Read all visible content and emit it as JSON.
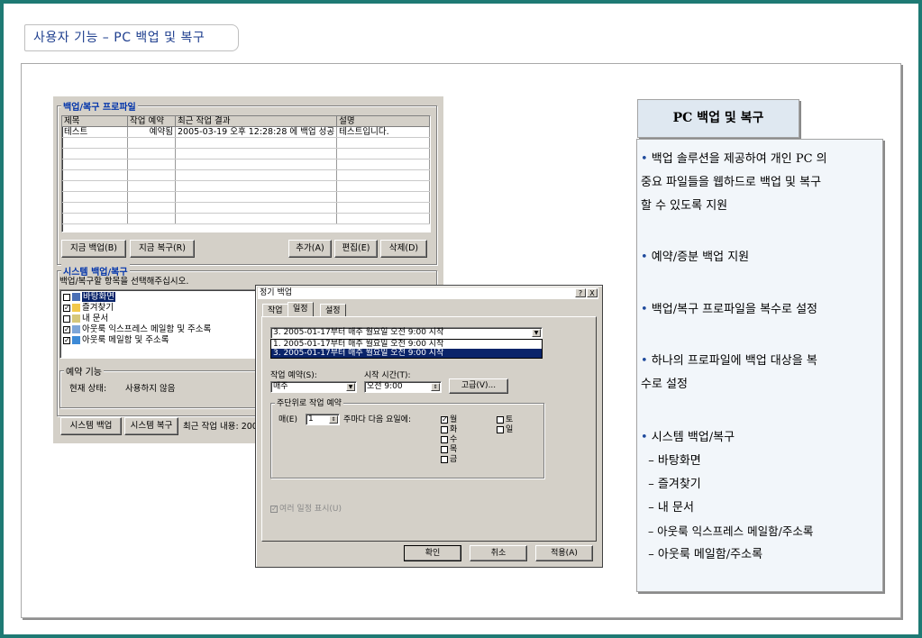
{
  "header": {
    "title": "사용자 기능 – PC 백업 및 복구"
  },
  "profile_group": {
    "title": "백업/복구 프로파일",
    "columns": [
      "제목",
      "작업 예약",
      "최근 작업 결과",
      "설명"
    ],
    "rows": [
      [
        "테스트",
        "예약됨",
        "2005-03-19 오후 12:28:28 에 백업 성공",
        "테스트입니다."
      ]
    ],
    "buttons": {
      "backup_now": "지금 백업(B)",
      "restore_now": "지금 복구(R)",
      "add": "추가(A)",
      "edit": "편집(E)",
      "delete": "삭제(D)"
    }
  },
  "system_group": {
    "title": "시스템 백업/복구",
    "instruction": "백업/복구할 항목을 선택해주십시오.",
    "items": [
      "바탕화면",
      "즐겨찾기",
      "내 문서",
      "아웃룩 익스프레스 메일함 및 주소록",
      "아웃룩 메일함 및 주소록"
    ],
    "checked": [
      false,
      true,
      false,
      true,
      true
    ]
  },
  "schedule_group": {
    "title": "예약 기능",
    "status_label": "현재 상태:",
    "status_value": "사용하지 않음"
  },
  "bottom": {
    "system_backup": "시스템 백업",
    "system_restore": "시스템 복구",
    "last_job": "최근 작업 내용: 2005"
  },
  "dialog": {
    "title": "정기 백업",
    "help": "?",
    "close": "X",
    "tabs": [
      "작업",
      "일정",
      "설정"
    ],
    "schedule_combo": "3. 2005-01-17부터 매주 월요일 오전 9:00 시작",
    "schedule_options": [
      "1. 2005-01-17부터 매주 월요일 오전 9:00 시작",
      "3. 2005-01-17부터 매주 월요일 오전 9:00 시작"
    ],
    "schedule_label": "작업 예약(S):",
    "schedule_value": "매주",
    "start_label": "시작 시간(T):",
    "start_value": "오전  9:00",
    "advanced": "고급(V)...",
    "weekly_group": "주단위로 작업 예약",
    "every_label": "매(E)",
    "every_value": "1",
    "every_suffix": "주마다 다음 요일에:",
    "days_left": [
      "월",
      "화",
      "수",
      "목",
      "금"
    ],
    "days_left_checked": [
      true,
      false,
      false,
      false,
      false
    ],
    "days_right": [
      "토",
      "일"
    ],
    "multi_schedule": "여러 일정 표시(U)",
    "ok": "확인",
    "cancel": "취소",
    "apply": "적용(A)"
  },
  "panel": {
    "title": "PC 백업 및 복구",
    "lines": [
      {
        "bullet": "•",
        "text": " 백업 솔루션을 제공하여 개인 PC 의"
      },
      {
        "bullet": "",
        "text": "중요 파일들을 웹하드로 백업 및 복구"
      },
      {
        "bullet": "",
        "text": "할 수 있도록 지원"
      },
      {
        "bullet": "•",
        "text": " 예약/증분 백업 지원"
      },
      {
        "bullet": "•",
        "text": " 백업/복구 프로파일을 복수로 설정"
      },
      {
        "bullet": "•",
        "text": " 하나의 프로파일에 백업 대상을 복"
      },
      {
        "bullet": "",
        "text": "수로 설정"
      },
      {
        "bullet": "•",
        "text": " 시스템 백업/복구"
      },
      {
        "bullet": "",
        "text": "  – 바탕화면"
      },
      {
        "bullet": "",
        "text": "  – 즐겨찾기"
      },
      {
        "bullet": "",
        "text": "  – 내 문서"
      },
      {
        "bullet": "",
        "text": "  – 아웃룩 익스프레스 메일함/주소록"
      },
      {
        "bullet": "",
        "text": "  – 아웃룩 메일함/주소록"
      }
    ]
  },
  "colors": {
    "frame": "#1e7a74",
    "title_text": "#1f3f8f",
    "panel_bg": "#f2f6fa",
    "panel_header_bg": "#dfe8f1",
    "selection": "#0a246a"
  }
}
